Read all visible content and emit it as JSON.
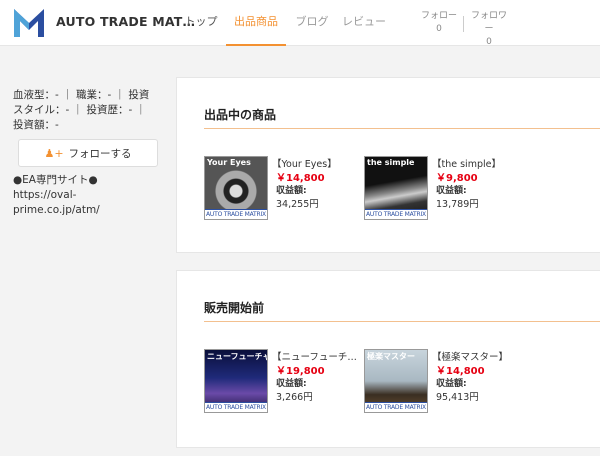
{
  "header": {
    "brand": "AUTO TRADE MAT…",
    "nav": [
      {
        "label": "トップ"
      },
      {
        "label": "出品商品"
      },
      {
        "label": "ブログ"
      },
      {
        "label": "レビュー"
      }
    ],
    "follow_label": "フォロー",
    "follow_count": "0",
    "follower_label": "フォロワー",
    "follower_count": "0"
  },
  "profile": {
    "info": "血液型：- ｜ 職業：- ｜ 投資スタイル：- ｜ 投資歴：- ｜ 投資額：-",
    "follow_button": "フォローする",
    "ea_site": "●EA専門サイト● https://oval-prime.co.jp/atm/"
  },
  "sections": [
    {
      "title": "出品中の商品",
      "products": [
        {
          "thumb_title": "Your Eyes",
          "thumb_footer": "AUTO TRADE MATRIX",
          "name": "【Your Eyes】",
          "price": "￥14,800",
          "profit_label": "収益額:",
          "profit": "34,255円"
        },
        {
          "thumb_title": "the simple",
          "thumb_footer": "AUTO TRADE MATRIX",
          "name": "【the simple】",
          "price": "￥9,800",
          "profit_label": "収益額:",
          "profit": "13,789円"
        }
      ]
    },
    {
      "title": "販売開始前",
      "products": [
        {
          "thumb_title": "ニューフューチャー",
          "thumb_footer": "AUTO TRADE MATRIX",
          "name": "【ニューフューチ…",
          "price": "￥19,800",
          "profit_label": "収益額:",
          "profit": "3,266円"
        },
        {
          "thumb_title": "極楽マスター",
          "thumb_footer": "AUTO TRADE MATRIX",
          "name": "【極楽マスター】",
          "price": "￥14,800",
          "profit_label": "収益額:",
          "profit": "95,413円"
        }
      ]
    }
  ],
  "colors": {
    "accent": "#f39131",
    "price": "#e60012",
    "logo_blue": "#2b4ea0"
  }
}
